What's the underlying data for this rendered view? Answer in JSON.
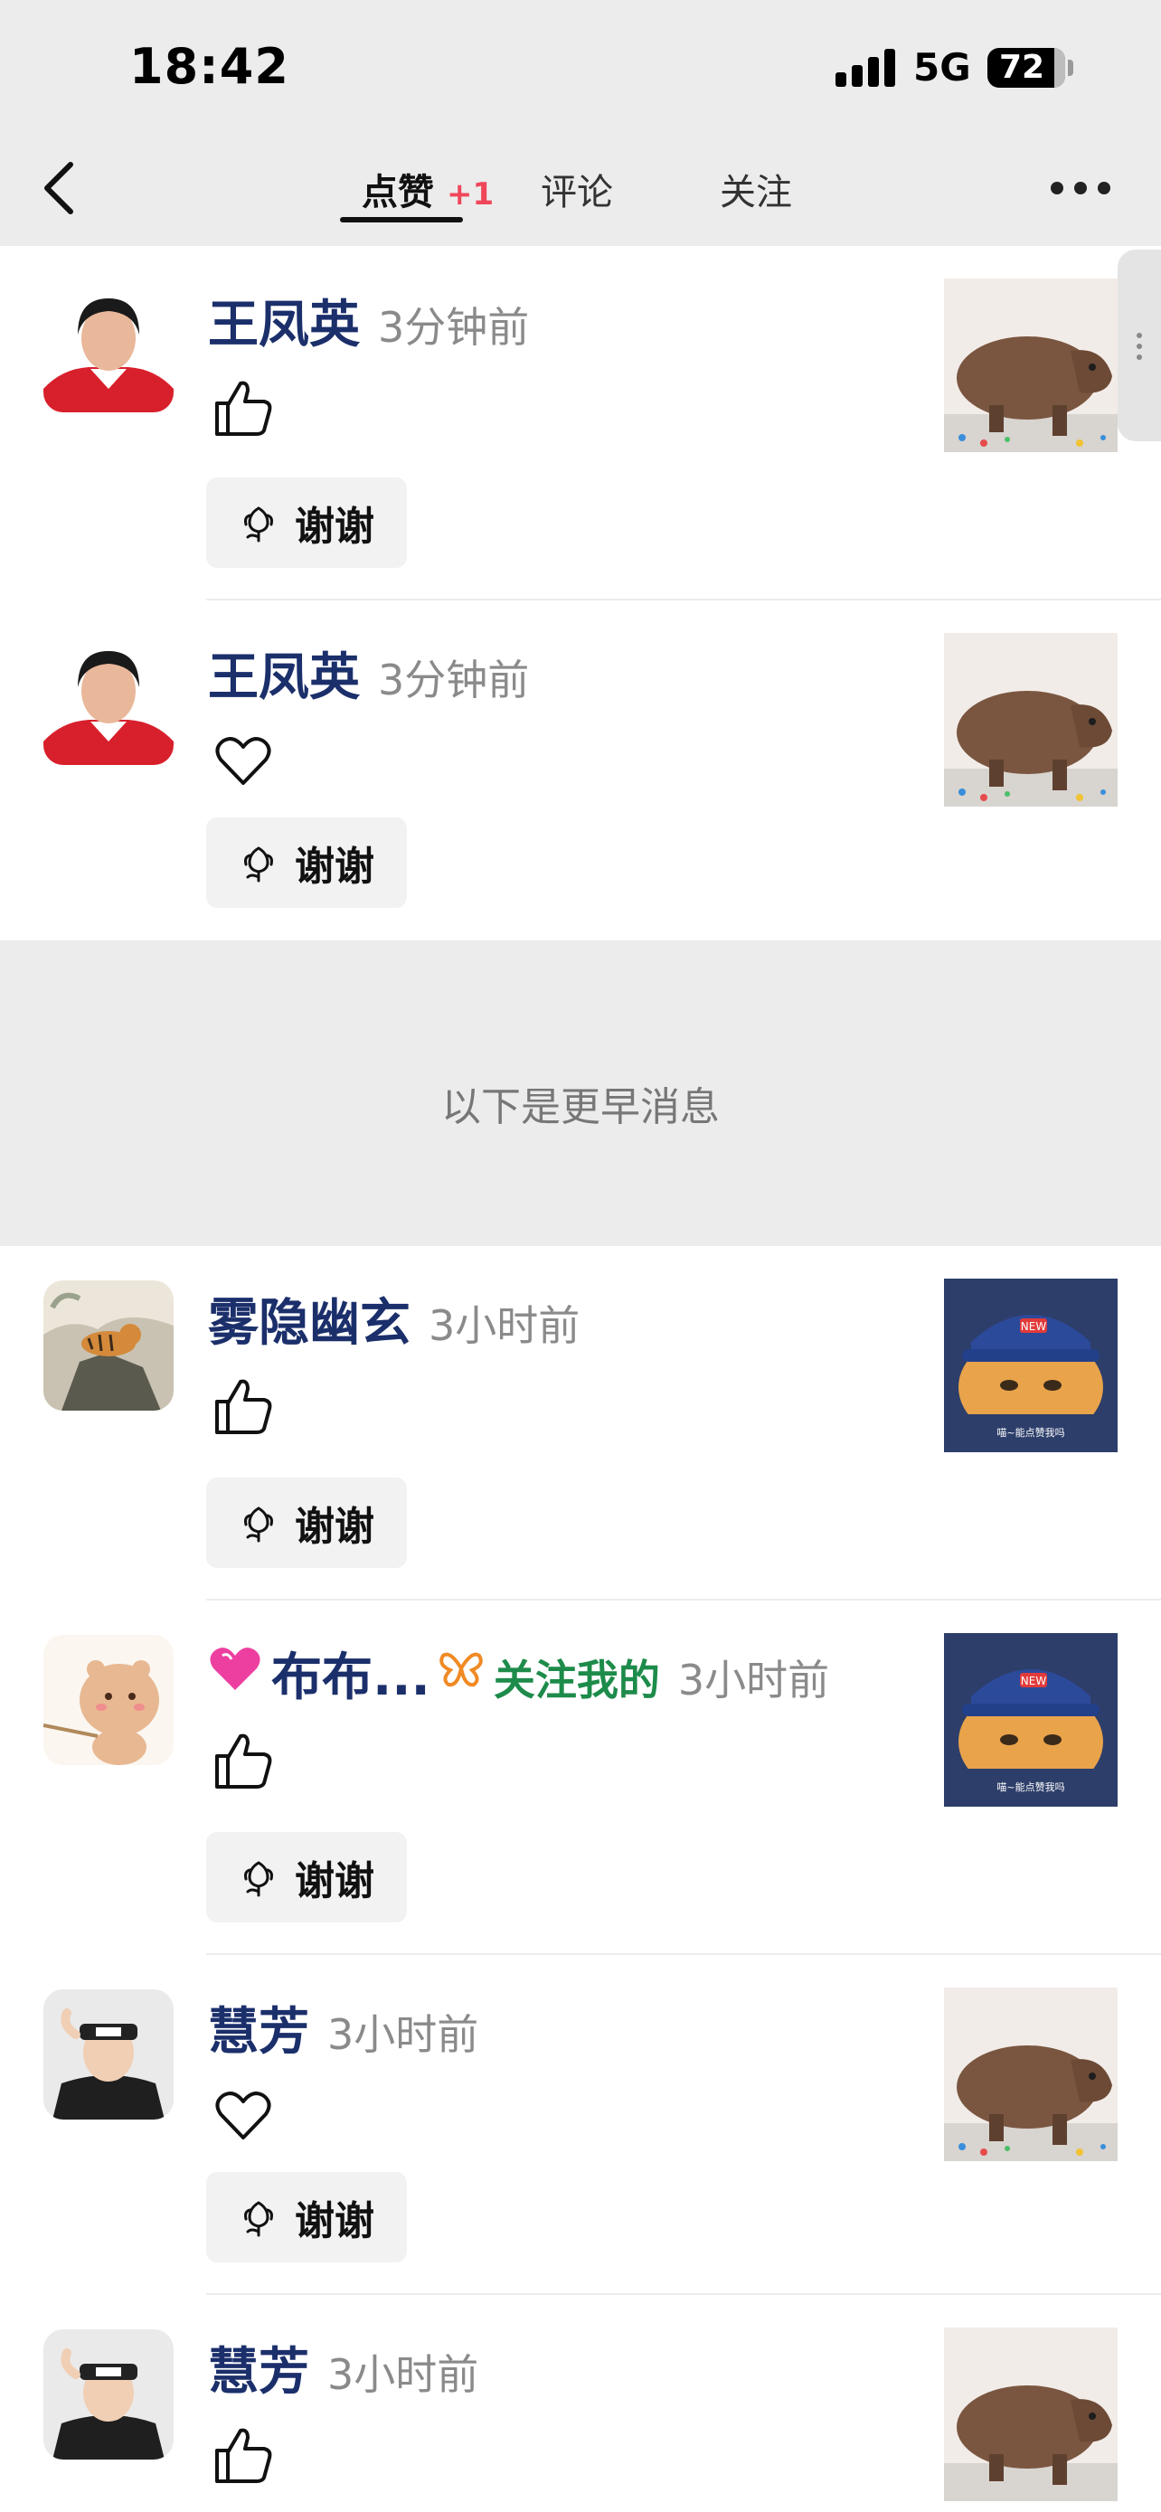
{
  "status_bar": {
    "time": "18:42",
    "network": "5G",
    "battery": "72"
  },
  "tabs": [
    {
      "label": "点赞",
      "badge": "+1"
    },
    {
      "label": "评论"
    },
    {
      "label": "关注"
    }
  ],
  "separator_text": "以下是更早消息",
  "items": [
    {
      "name": "王凤英",
      "time": "3分钟前",
      "action": "like",
      "thanks": "谢谢"
    },
    {
      "name": "王凤英",
      "time": "3分钟前",
      "action": "heart",
      "thanks": "谢谢"
    },
    {
      "name": "雾隐幽玄",
      "time": "3小时前",
      "action": "like",
      "thanks": "谢谢"
    },
    {
      "name": "布布...",
      "tag": "关注我的",
      "time": "3小时前",
      "action": "like",
      "thanks": "谢谢"
    },
    {
      "name": "慧芳",
      "time": "3小时前",
      "action": "heart",
      "thanks": "谢谢"
    },
    {
      "name": "慧芳",
      "time": "3小时前",
      "action": "like"
    }
  ],
  "thumb_cat_caption": "喵~能点赞我吗",
  "cap_text": "NEW",
  "colors": {
    "name": "#1b2f6b",
    "badge": "#f0465a",
    "tag": "#1d8b4a",
    "time": "#8a8a8a",
    "bg_gray": "#ececec"
  }
}
